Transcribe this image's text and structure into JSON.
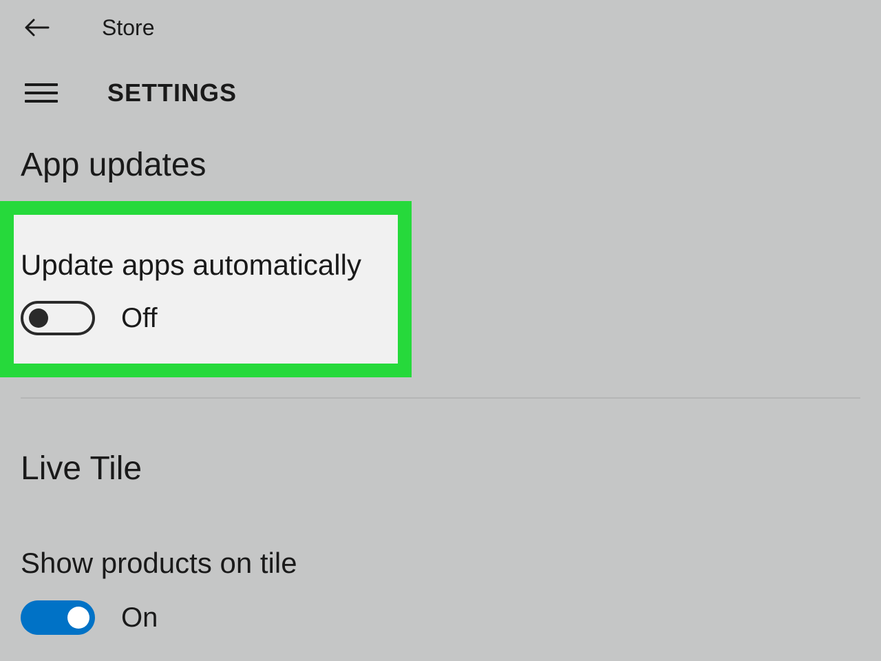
{
  "topbar": {
    "app_title": "Store"
  },
  "header": {
    "page_title": "SETTINGS"
  },
  "sections": {
    "app_updates": {
      "heading": "App updates",
      "update_auto": {
        "label": "Update apps automatically",
        "state_text": "Off",
        "state": false
      }
    },
    "live_tile": {
      "heading": "Live Tile",
      "show_products": {
        "label": "Show products on tile",
        "state_text": "On",
        "state": true
      }
    }
  }
}
